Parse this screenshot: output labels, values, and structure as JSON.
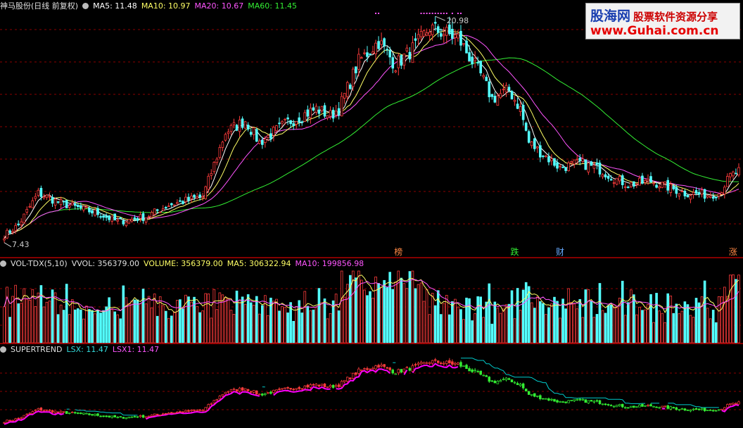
{
  "header_main": {
    "stock": "神马股份(日线 前复权)",
    "ma5": "MA5: 11.48",
    "ma10": "MA10: 10.97",
    "ma20": "MA20: 10.67",
    "ma60": "MA60: 11.45"
  },
  "header_vol": {
    "name": "VOL-TDX(5,10)",
    "vvol": "VVOL: 356379.00",
    "volume": "VOLUME: 356379.00",
    "ma5": "MA5: 306322.94",
    "ma10": "MA10: 199856.98"
  },
  "header_st": {
    "name": "SUPERTREND",
    "lsx": "LSX: 11.47",
    "lsx1": "LSX1: 11.47"
  },
  "logo": {
    "line1": "股海网",
    "line1_sub": "股票软件资源分享",
    "line2": "www.Guhai.com.cn"
  },
  "colors": {
    "up": "#ff3c3c",
    "down": "#54ffff",
    "ma5": "#ffffff",
    "ma10": "#ffff66",
    "ma20": "#ff55ff",
    "ma60": "#33ee33",
    "grid": "#8b0000",
    "st_down_line": "#00cccc"
  },
  "chart_data": {
    "type": "candlestick",
    "price_range": [
      7.43,
      20.98
    ],
    "high_label": "20.98",
    "low_label": "7.43",
    "bars": 260,
    "keypoints": [
      [
        0,
        8.1
      ],
      [
        5,
        8.7
      ],
      [
        12,
        10.6
      ],
      [
        20,
        10.0
      ],
      [
        33,
        9.4
      ],
      [
        40,
        8.9
      ],
      [
        50,
        9.2
      ],
      [
        58,
        9.9
      ],
      [
        70,
        10.4
      ],
      [
        78,
        14.2
      ],
      [
        85,
        14.9
      ],
      [
        90,
        13.6
      ],
      [
        100,
        14.8
      ],
      [
        110,
        15.6
      ],
      [
        115,
        15.2
      ],
      [
        118,
        15.6
      ],
      [
        125,
        18.4
      ],
      [
        132,
        19.6
      ],
      [
        138,
        18.2
      ],
      [
        145,
        19.3
      ],
      [
        150,
        20.4
      ],
      [
        160,
        19.8
      ],
      [
        168,
        17.6
      ],
      [
        172,
        16.2
      ],
      [
        178,
        16.7
      ],
      [
        182,
        15.6
      ],
      [
        185,
        13.6
      ],
      [
        190,
        12.9
      ],
      [
        196,
        12.1
      ],
      [
        203,
        12.4
      ],
      [
        210,
        12.0
      ],
      [
        215,
        11.5
      ],
      [
        220,
        11.1
      ],
      [
        228,
        11.3
      ],
      [
        235,
        10.9
      ],
      [
        240,
        10.6
      ],
      [
        248,
        10.5
      ],
      [
        252,
        10.6
      ],
      [
        256,
        11.6
      ],
      [
        259,
        11.9
      ]
    ],
    "signals": [
      {
        "bar": 139,
        "label": "榜"
      },
      {
        "bar": 180,
        "label": "跌"
      },
      {
        "bar": 196,
        "label": "财"
      },
      {
        "bar": 257,
        "label": "涨"
      }
    ]
  }
}
